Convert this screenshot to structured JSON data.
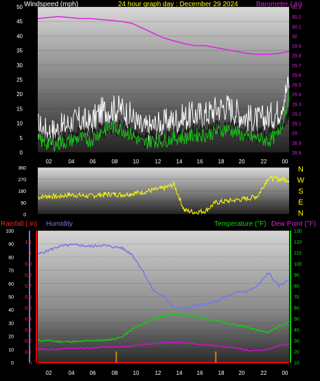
{
  "header": {
    "windspeed_label": "Windspeed (mph)",
    "title": "24 hour graph day : December 29 2024",
    "barometer_label": "Barometer (.in)",
    "rainfall_label": "Rainfall (.in)",
    "humidity_label": "Humidity",
    "temperature_label": "Temperature (°F)",
    "dewpoint_label": "Dew Point (°F)"
  },
  "colors": {
    "wind_gust": "#ffffff",
    "wind_avg": "#11cc11",
    "barometer": "#dd22dd",
    "direction": "#ffff00",
    "humidity": "#7777ee",
    "temperature": "#11cc11",
    "dewpoint": "#cc11cc",
    "rainfall": "#ff0000",
    "rain_marks": "#cc8800"
  },
  "chart_data": [
    {
      "id": "wind",
      "type": "line",
      "x_ticks": [
        "02",
        "04",
        "06",
        "08",
        "10",
        "12",
        "14",
        "16",
        "18",
        "20",
        "22",
        "00"
      ],
      "ylim_left": [
        0,
        50
      ],
      "y_ticks_left": [
        "0",
        "5",
        "10",
        "15",
        "20",
        "25",
        "30",
        "35",
        "40",
        "45",
        "50"
      ],
      "ylim_right": [
        28.8,
        30.3
      ],
      "y_ticks_right": [
        "28.8",
        "28.9",
        "29",
        "29.1",
        "29.2",
        "29.3",
        "29.4",
        "29.5",
        "29.6",
        "29.7",
        "29.8",
        "29.9",
        "30",
        "30.1",
        "30.2",
        "30.3"
      ],
      "x": [
        0,
        1,
        2,
        3,
        4,
        5,
        6,
        7,
        8,
        9,
        10,
        11,
        12,
        13,
        14,
        15,
        16,
        17,
        18,
        19,
        20,
        21,
        22,
        23,
        24
      ],
      "series": [
        {
          "key": "gust",
          "values": [
            9,
            7,
            8,
            10,
            11,
            10,
            14,
            15,
            15,
            12,
            8,
            9,
            10,
            11,
            12,
            13,
            13,
            15,
            16,
            14,
            12,
            11,
            12,
            14,
            24
          ]
        },
        {
          "key": "avg",
          "values": [
            4,
            3,
            3,
            4,
            5,
            4,
            7,
            9,
            8,
            6,
            3,
            4,
            4,
            5,
            5,
            6,
            6,
            7,
            8,
            7,
            5,
            5,
            4,
            6,
            19
          ]
        },
        {
          "key": "barometer",
          "values": [
            30.18,
            30.19,
            30.2,
            30.19,
            30.18,
            30.18,
            30.17,
            30.16,
            30.15,
            30.13,
            30.08,
            30.03,
            29.98,
            29.95,
            29.92,
            29.9,
            29.9,
            29.88,
            29.86,
            29.84,
            29.82,
            29.81,
            29.81,
            29.82,
            29.84
          ]
        }
      ]
    },
    {
      "id": "direction",
      "type": "line",
      "ylim": [
        0,
        360
      ],
      "y_ticks": [
        "0",
        "90",
        "180",
        "270",
        "360"
      ],
      "compass": [
        "N",
        "W",
        "S",
        "E",
        "N"
      ],
      "x": [
        0,
        1,
        2,
        3,
        4,
        5,
        6,
        7,
        8,
        9,
        10,
        11,
        12,
        13,
        14,
        15,
        16,
        17,
        18,
        19,
        20,
        21,
        22,
        23,
        24
      ],
      "values": [
        130,
        140,
        135,
        150,
        145,
        140,
        150,
        155,
        150,
        160,
        170,
        185,
        200,
        230,
        30,
        15,
        25,
        90,
        100,
        110,
        120,
        140,
        280,
        270,
        265
      ]
    },
    {
      "id": "temp_hum",
      "type": "line",
      "x_ticks": [
        "02",
        "04",
        "06",
        "08",
        "10",
        "12",
        "14",
        "16",
        "18",
        "20",
        "22",
        "00"
      ],
      "ylim_left": [
        0,
        100
      ],
      "y_ticks_left": [
        "0",
        "10",
        "20",
        "30",
        "40",
        "50",
        "60",
        "70",
        "80",
        "90",
        "100"
      ],
      "rain_ylim": [
        0,
        1.2
      ],
      "rain_ticks": [
        "0",
        "0.1",
        "0.2",
        "0.3",
        "0.4",
        "0.5",
        "0.6",
        "0.7",
        "0.8",
        "0.9",
        "1",
        "1.1"
      ],
      "ylim_right": [
        10,
        130
      ],
      "y_ticks_right": [
        "10",
        "20",
        "30",
        "40",
        "50",
        "60",
        "70",
        "80",
        "90",
        "100",
        "110",
        "120",
        "130"
      ],
      "x": [
        0,
        1,
        2,
        3,
        4,
        5,
        6,
        7,
        8,
        9,
        10,
        11,
        12,
        13,
        14,
        15,
        16,
        17,
        18,
        19,
        20,
        21,
        22,
        23,
        24
      ],
      "series": [
        {
          "key": "humidity",
          "values": [
            82,
            85,
            88,
            89,
            89,
            88,
            89,
            88,
            87,
            82,
            70,
            55,
            50,
            42,
            41,
            43,
            44,
            46,
            50,
            53,
            54,
            58,
            68,
            58,
            63
          ]
        },
        {
          "key": "temperature",
          "values": [
            30,
            30,
            29,
            29,
            29,
            30,
            30,
            31,
            33,
            40,
            45,
            49,
            52,
            54,
            53,
            52,
            50,
            48,
            46,
            44,
            42,
            40,
            37,
            43,
            47
          ]
        },
        {
          "key": "dewpoint",
          "values": [
            22,
            22,
            22,
            23,
            23,
            23,
            24,
            24,
            24,
            25,
            26,
            27,
            28,
            28,
            28,
            27,
            26,
            25,
            24,
            23,
            21,
            21,
            22,
            25,
            27
          ]
        },
        {
          "key": "rainfall",
          "values": [
            0,
            0,
            0,
            0,
            0,
            0,
            0,
            0,
            0,
            0,
            0,
            0,
            0,
            0,
            0,
            0,
            0,
            0,
            0,
            0,
            0,
            0,
            0,
            0,
            0
          ]
        }
      ],
      "rain_markers_x": [
        7.5,
        17.0
      ]
    }
  ]
}
